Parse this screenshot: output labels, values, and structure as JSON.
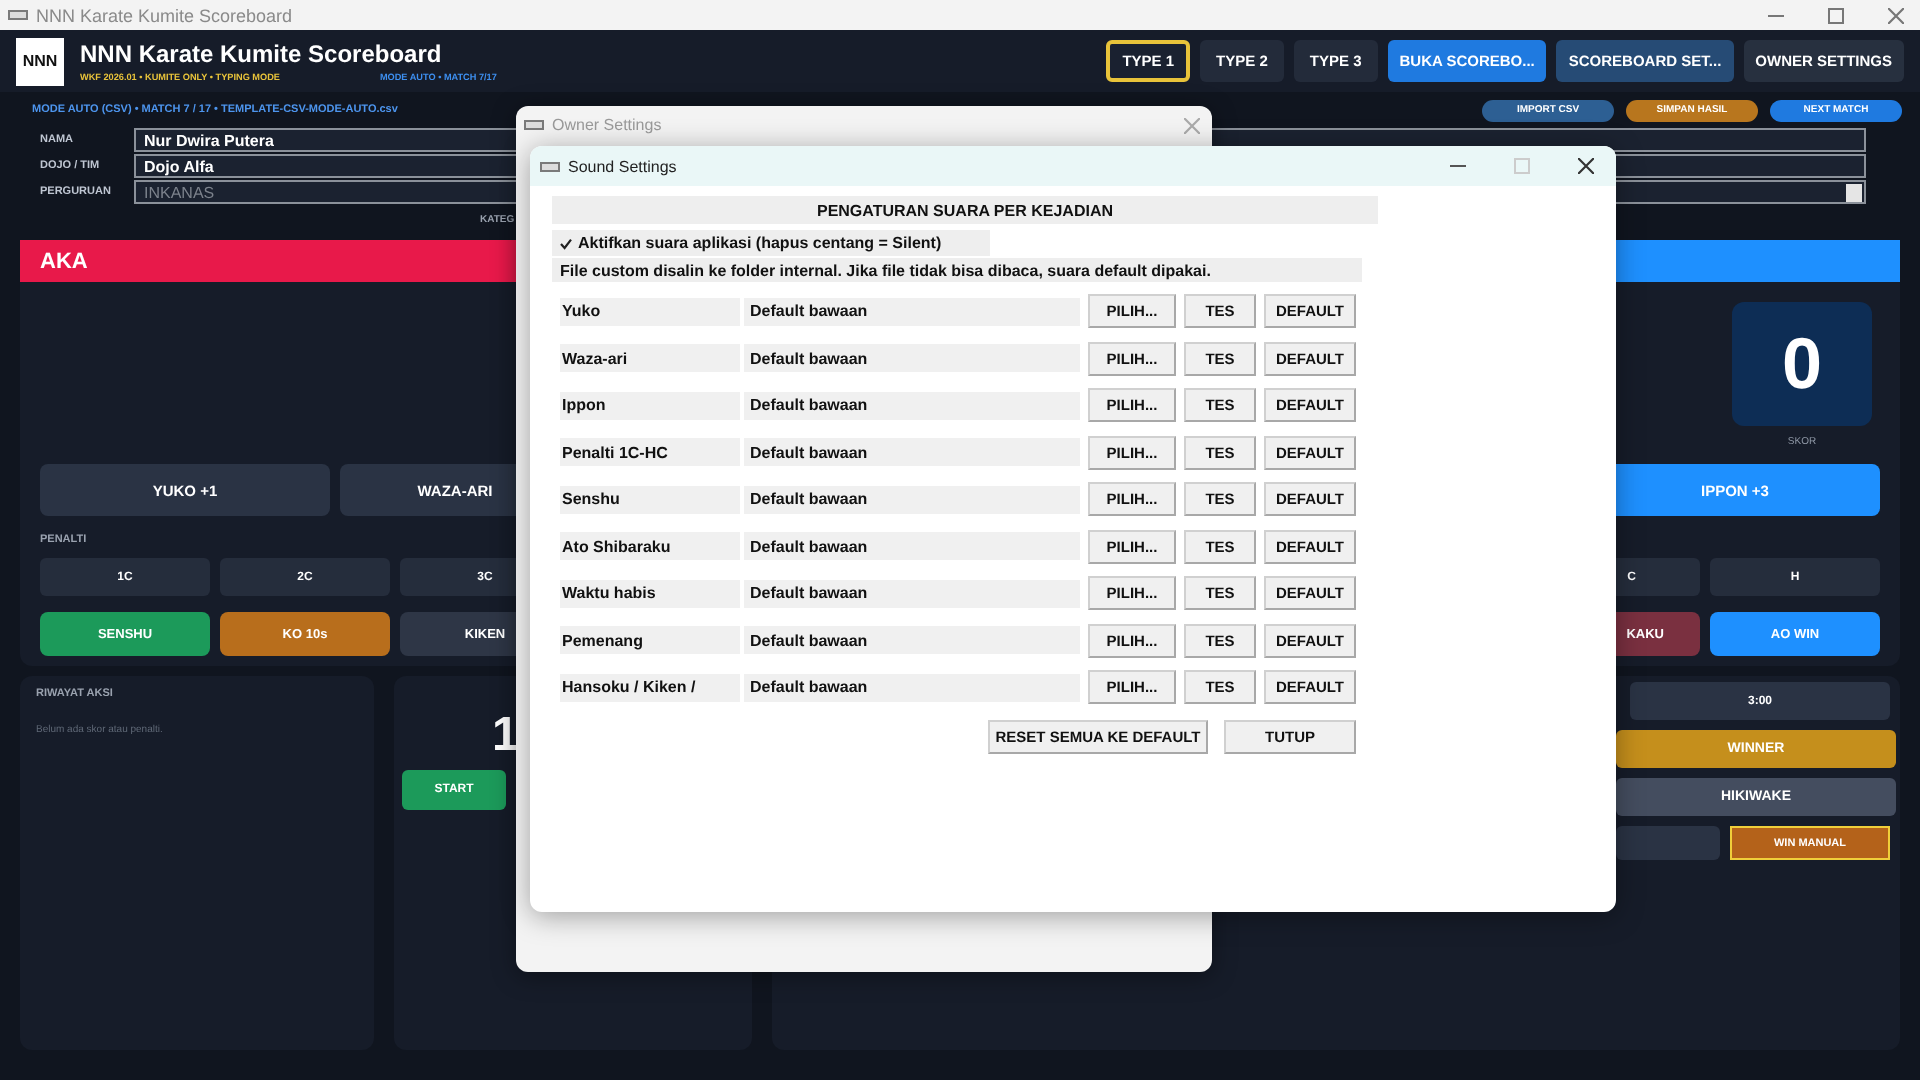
{
  "window": {
    "title": "NNN Karate Kumite Scoreboard"
  },
  "header": {
    "logo": "NNN",
    "title": "NNN Karate Kumite Scoreboard",
    "subtitle": "WKF 2026.01 • KUMITE ONLY • TYPING MODE",
    "mode": "MODE AUTO • MATCH 7/17",
    "tabs": [
      {
        "label": "TYPE 1",
        "selected": true
      },
      {
        "label": "TYPE 2",
        "selected": false
      },
      {
        "label": "TYPE 3",
        "selected": false
      }
    ],
    "buttons": [
      {
        "label": "BUKA SCOREBO...",
        "kind": "primary"
      },
      {
        "label": "SCOREBOARD SET...",
        "kind": "secondary"
      },
      {
        "label": "OWNER SETTINGS",
        "kind": "plain"
      }
    ]
  },
  "match_bar": {
    "info": "MODE AUTO (CSV) • MATCH 7 / 17 • TEMPLATE-CSV-MODE-AUTO.csv",
    "buttons": [
      {
        "label": "IMPORT CSV",
        "kind": "import"
      },
      {
        "label": "SIMPAN HASIL",
        "kind": "save"
      },
      {
        "label": "NEXT MATCH",
        "kind": "next"
      }
    ]
  },
  "fields": [
    {
      "label": "NAMA",
      "value": "Nur Dwira Putera",
      "kind": "text"
    },
    {
      "label": "DOJO / TIM",
      "value": "Dojo Alfa",
      "kind": "text"
    },
    {
      "label": "PERGURUAN",
      "placeholder": "INKANAS",
      "kind": "dropdown"
    }
  ],
  "category_label": "KATEG",
  "aka": {
    "name": "AKA",
    "scores": [
      "YUKO +1",
      "WAZA-ARI"
    ],
    "penalty_label": "PENALTI",
    "penalties": [
      "1C",
      "2C",
      "3C"
    ],
    "actions": [
      {
        "label": "SENSHU",
        "kind": "senshu"
      },
      {
        "label": "KO 10s",
        "kind": "ko"
      },
      {
        "label": "KIKEN",
        "kind": "kiken"
      }
    ]
  },
  "ao": {
    "score": "0",
    "score_label": "SKOR",
    "scores": [
      "IPPON +3"
    ],
    "penalties": [
      "C",
      "H"
    ],
    "actions": [
      {
        "label": "KAKU",
        "kind": "shikkaku"
      },
      {
        "label": "AO WIN",
        "kind": "win"
      }
    ]
  },
  "history": {
    "title": "RIWAYAT AKSI",
    "empty": "Belum ada skor atau penalti."
  },
  "timer": {
    "time": "1",
    "start": "START"
  },
  "result": {
    "duration": "3:00",
    "winner": "WINNER",
    "draw": "HIKIWAKE",
    "manual": "WIN MANUAL"
  },
  "owner_dialog": {
    "title": "Owner Settings"
  },
  "sound_dialog": {
    "title": "Sound Settings",
    "heading": "PENGATURAN SUARA PER KEJADIAN",
    "enable": {
      "label": "Aktifkan suara aplikasi (hapus centang = Silent)",
      "checked": true
    },
    "note": "File custom disalin ke folder internal. Jika file tidak bisa dibaca, suara default dipakai.",
    "rows": [
      {
        "event": "Yuko",
        "file": "Default bawaan",
        "buttons": [
          "PILIH...",
          "TES",
          "DEFAULT"
        ]
      },
      {
        "event": "Waza-ari",
        "file": "Default bawaan",
        "buttons": [
          "PILIH...",
          "TES",
          "DEFAULT"
        ]
      },
      {
        "event": "Ippon",
        "file": "Default bawaan",
        "buttons": [
          "PILIH...",
          "TES",
          "DEFAULT"
        ]
      },
      {
        "event": "Penalti 1C-HC",
        "file": "Default bawaan",
        "buttons": [
          "PILIH...",
          "TES",
          "DEFAULT"
        ]
      },
      {
        "event": "Senshu",
        "file": "Default bawaan",
        "buttons": [
          "PILIH...",
          "TES",
          "DEFAULT"
        ]
      },
      {
        "event": "Ato Shibaraku",
        "file": "Default bawaan",
        "buttons": [
          "PILIH...",
          "TES",
          "DEFAULT"
        ]
      },
      {
        "event": "Waktu habis",
        "file": "Default bawaan",
        "buttons": [
          "PILIH...",
          "TES",
          "DEFAULT"
        ]
      },
      {
        "event": "Pemenang",
        "file": "Default bawaan",
        "buttons": [
          "PILIH...",
          "TES",
          "DEFAULT"
        ]
      },
      {
        "event": "Hansoku / Kiken /",
        "file": "Default bawaan",
        "buttons": [
          "PILIH...",
          "TES",
          "DEFAULT"
        ]
      }
    ],
    "footer_buttons": [
      "RESET SEMUA KE DEFAULT",
      "TUTUP"
    ]
  }
}
